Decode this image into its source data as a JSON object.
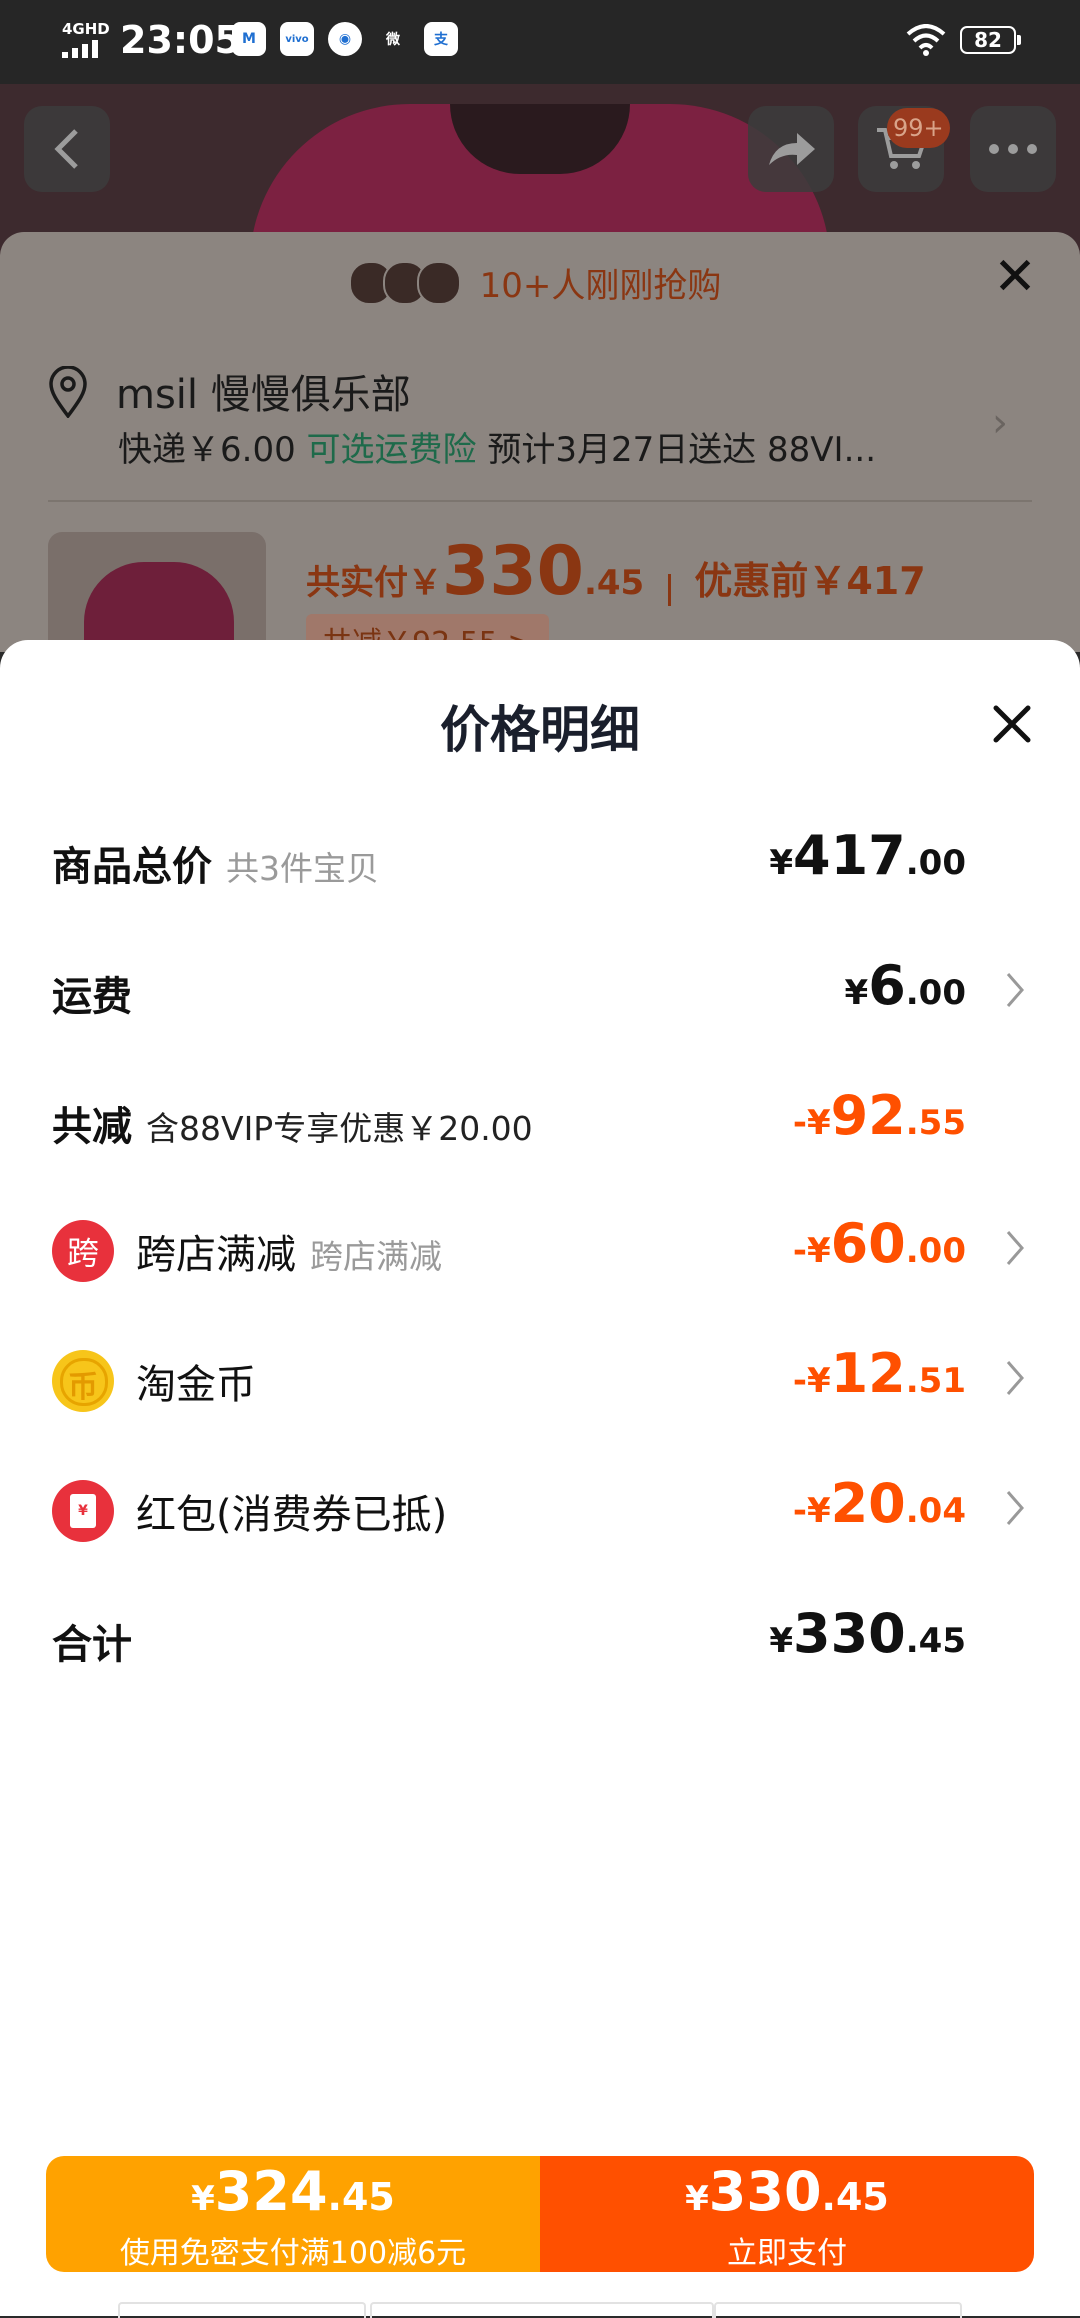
{
  "status_bar": {
    "network": "4GHD",
    "time": "23:05",
    "battery": "82",
    "apps": [
      {
        "name": "meitu-app-icon",
        "glyph": "M"
      },
      {
        "name": "vivo-app-icon",
        "glyph": "vivo"
      },
      {
        "name": "browser-app-icon",
        "glyph": "◉"
      },
      {
        "name": "weibo-app-icon",
        "glyph": "微"
      },
      {
        "name": "alipay-app-icon",
        "glyph": "支"
      }
    ]
  },
  "background": {
    "cart_badge": "99+",
    "recent_buyers": "10+人刚刚抢购",
    "address_name": "msil 慢慢俱乐部",
    "shipping_prefix": "快递￥6.00",
    "shipping_insurance": "可选运费险",
    "shipping_suffix": "预计3月27日送达 88VI...",
    "paid_label": "共实付￥",
    "paid_int": "330",
    "paid_dec": ".45",
    "orig_label": "优惠前￥417",
    "saved_chip": "共减￥92.55 >"
  },
  "sheet": {
    "title": "价格明细",
    "rows": {
      "total": {
        "label": "商品总价",
        "sub": "共3件宝贝",
        "cur": "¥",
        "int": "417",
        "dec": ".00"
      },
      "shipping": {
        "label": "运费",
        "cur": "¥",
        "int": "6",
        "dec": ".00"
      },
      "discount": {
        "label": "共减",
        "sub": "含88VIP专享优惠￥20.00",
        "cur": "-¥",
        "int": "92",
        "dec": ".55"
      },
      "cross_store": {
        "icon_text": "跨",
        "label": "跨店满减",
        "sub": "跨店满减",
        "cur": "-¥",
        "int": "60",
        "dec": ".00"
      },
      "coins": {
        "icon_text": "币",
        "label": "淘金币",
        "cur": "-¥",
        "int": "12",
        "dec": ".51"
      },
      "red_packet": {
        "icon_text": "¥",
        "label": "红包(消费券已抵)",
        "cur": "-¥",
        "int": "20",
        "dec": ".04"
      },
      "sum": {
        "label": "合计",
        "cur": "¥",
        "int": "330",
        "dec": ".45"
      }
    }
  },
  "pay_bar": {
    "left": {
      "cur": "¥",
      "int": "324",
      "dec": ".45",
      "sub": "使用免密支付满100减6元"
    },
    "right": {
      "cur": "¥",
      "int": "330",
      "dec": ".45",
      "sub": "立即支付"
    }
  },
  "colors": {
    "accent_orange": "#ff5000",
    "pay_yellow": "#ffa200",
    "coupon_red": "#e8313c"
  }
}
